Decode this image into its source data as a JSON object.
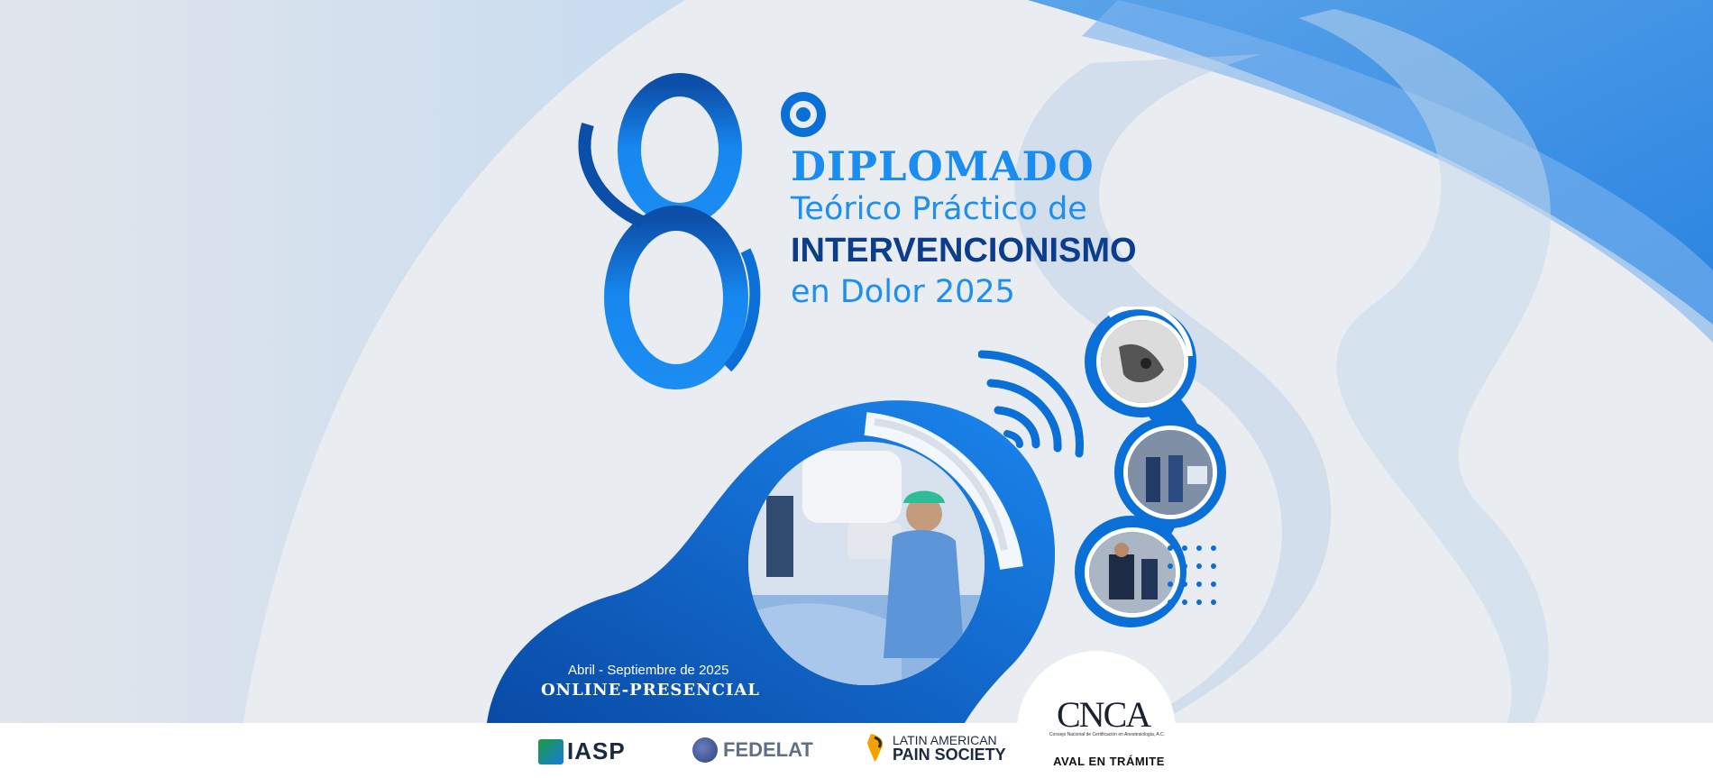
{
  "edition": {
    "number": "8",
    "ordinal_icon": "ordinal-degree-icon"
  },
  "title": {
    "line1": "DIPLOMADO",
    "line2": "Teórico Práctico de",
    "line3": "INTERVENCIONISMO",
    "line4": "en Dolor 2025"
  },
  "schedule": {
    "dates": "Abril - Septiembre de 2025",
    "mode": "ONLINE-PRESENCIAL"
  },
  "photos": {
    "main": "procedure-photo",
    "thumbs": [
      "fluoroscopy-image",
      "team-photo",
      "workshop-photo"
    ]
  },
  "sponsors": [
    {
      "name": "IASP",
      "icon": "iasp-logo"
    },
    {
      "name": "FEDELAT",
      "icon": "fedelat-logo"
    },
    {
      "name_top": "LATIN AMERICAN",
      "name_bottom": "PAIN SOCIETY",
      "icon": "laps-logo"
    }
  ],
  "endorsement": {
    "logo_text": "CNCA",
    "logo_caption": "Consejo Nacional de Certificación en Anestesiología, A.C.",
    "status": "AVAL EN TRÁMITE"
  },
  "colors": {
    "primary_blue": "#0a6fd6",
    "light_blue": "#1b8cf0",
    "navy": "#0c3d8c",
    "background": "#e9ecf1"
  }
}
